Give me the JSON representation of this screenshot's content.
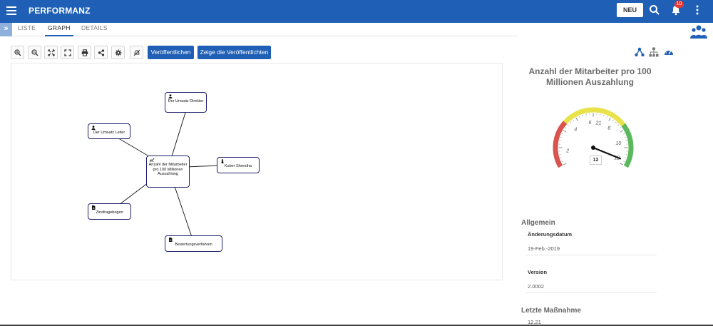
{
  "header": {
    "app_title": "PERFORMANZ",
    "new_button": "NEU",
    "notification_count": "10",
    "colors": {
      "primary": "#1f5fb5",
      "badge": "#e53935"
    }
  },
  "tabs": [
    {
      "label": "LISTE",
      "active": false
    },
    {
      "label": "GRAPH",
      "active": true
    },
    {
      "label": "DETAILS",
      "active": false
    }
  ],
  "toolbar": {
    "icons": [
      "zoom-in-icon",
      "zoom-out-icon",
      "fit-icon",
      "fullscreen-icon",
      "print-icon",
      "share-icon",
      "settings-icon",
      "hide-icon"
    ],
    "publish_label": "Veröffentlichen",
    "show_published_label": "Zeige die Veröffentlichten"
  },
  "graph": {
    "nodes": [
      {
        "id": "director",
        "label": "Der Umsatz Direktor",
        "icon": "person-icon"
      },
      {
        "id": "leader",
        "label": "Der Umsatz Leiter",
        "icon": "person-icon"
      },
      {
        "id": "center",
        "label": "Anzahl der Mitarbeiter pro 100 Millionen Auszahlung",
        "icon": "trend-icon"
      },
      {
        "id": "kuber",
        "label": "Kuber Shrestha",
        "icon": "person-female-icon"
      },
      {
        "id": "zins",
        "label": "Zinsfragebogen",
        "icon": "document-icon"
      },
      {
        "id": "bewertung",
        "label": "Bewertungsverfahren",
        "icon": "document-icon"
      }
    ]
  },
  "details": {
    "title": "Anzahl der Mitarbeiter pro 100 Millionen Auszahlung",
    "gauge": {
      "value": "12",
      "needle_value": 12,
      "min": 0,
      "max": 24,
      "tick_labels": [
        "2",
        "4",
        "6",
        "21",
        "8",
        "10",
        "12"
      ],
      "bands": {
        "red": "#d9534f",
        "yellow": "#e8e34a",
        "green": "#5cb85c"
      }
    },
    "general": {
      "heading": "Allgemein",
      "fields": [
        {
          "label": "Änderungsdatum",
          "value": "19-Feb.-2019"
        },
        {
          "label": "Version",
          "value": "2.0002"
        }
      ]
    },
    "last_action": {
      "heading": "Letzte Maßnahme",
      "value": "12.21"
    }
  }
}
